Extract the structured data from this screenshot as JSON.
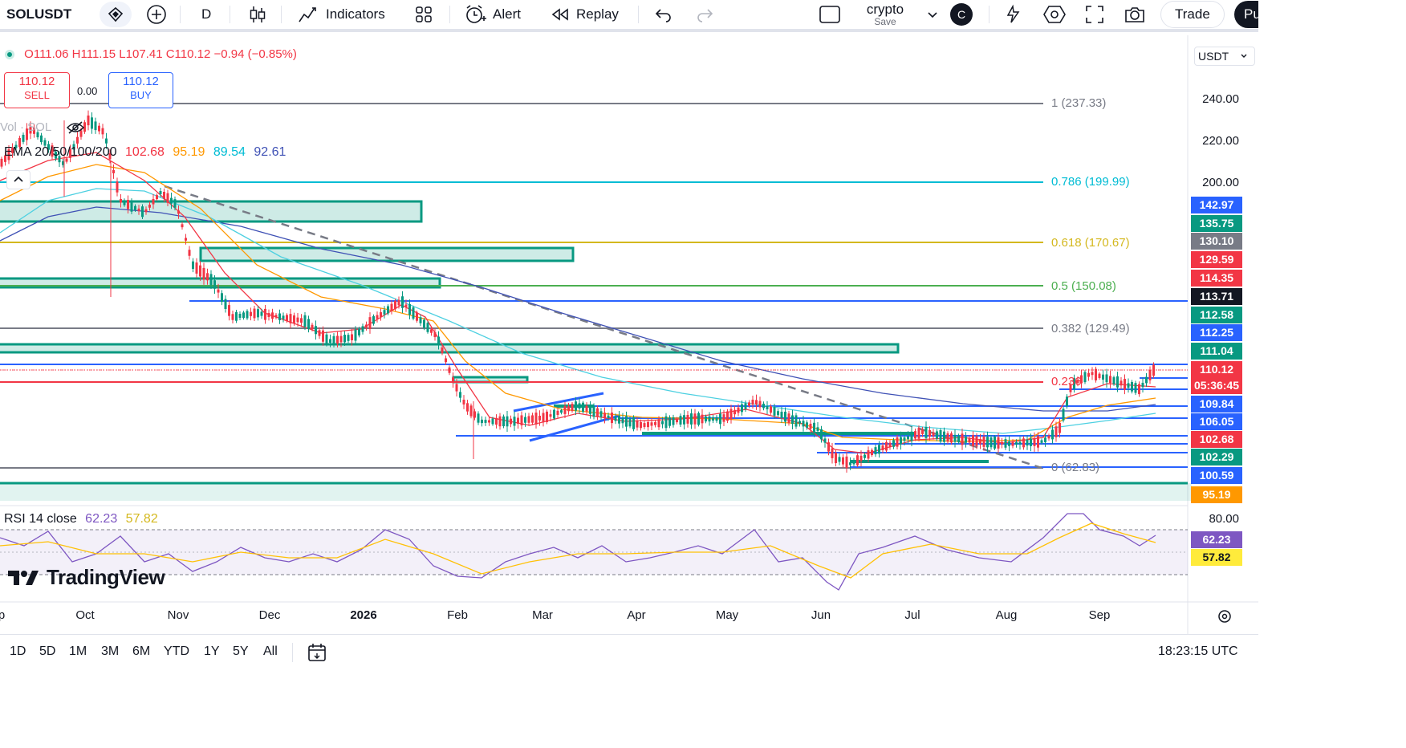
{
  "toolbar": {
    "symbol": "SOLUSDT",
    "interval": "D",
    "indicators": "Indicators",
    "alert": "Alert",
    "replay": "Replay",
    "layout_name": "crypto",
    "layout_save": "Save",
    "avatar_initial": "C",
    "trade": "Trade",
    "publish_partial": "Pu"
  },
  "legend": {
    "ohlc_line": "O111.06 H111.15 L107.41 C110.12 −0.94 (−0.85%)",
    "sell_price": "110.12",
    "sell_label": "SELL",
    "spread": "0.00",
    "buy_price": "110.12",
    "buy_label": "BUY",
    "vol_label": "Vol · SOL",
    "ema_label": "EMA 20/50/100/200",
    "ema20": "102.68",
    "ema50": "95.19",
    "ema100": "89.54",
    "ema200": "92.61",
    "rsi_label": "RSI 14 close",
    "rsi_value": "62.23",
    "rsi_ma": "57.82"
  },
  "currency": "USDT",
  "price_axis": [
    {
      "label": "240.00",
      "v": 240
    },
    {
      "label": "220.00",
      "v": 220
    },
    {
      "label": "200.00",
      "v": 200
    }
  ],
  "price_badges": [
    {
      "label": "142.97",
      "color": "#2962ff"
    },
    {
      "label": "135.75",
      "color": "#089981"
    },
    {
      "label": "130.10",
      "color": "#787b86"
    },
    {
      "label": "129.59",
      "color": "#f23645"
    },
    {
      "label": "114.35",
      "color": "#f23645"
    },
    {
      "label": "113.71",
      "color": "#131722"
    },
    {
      "label": "112.58",
      "color": "#089981"
    },
    {
      "label": "112.25",
      "color": "#2962ff"
    },
    {
      "label": "111.04",
      "color": "#089981"
    },
    {
      "label": "110.12",
      "color": "#f23645"
    },
    {
      "label": "05:36:45",
      "color": "#f23645"
    },
    {
      "label": "109.84",
      "color": "#2962ff"
    },
    {
      "label": "106.05",
      "color": "#2962ff"
    },
    {
      "label": "102.68",
      "color": "#f23645"
    },
    {
      "label": "102.29",
      "color": "#089981"
    },
    {
      "label": "100.59",
      "color": "#2962ff"
    },
    {
      "label": "95.19",
      "color": "#ff9800"
    }
  ],
  "fib_levels": [
    {
      "label": "1 (237.33)",
      "color": "#787b86"
    },
    {
      "label": "0.786 (199.99)",
      "color": "#00bcd4"
    },
    {
      "label": "0.618 (170.67)",
      "color": "#d4b81e"
    },
    {
      "label": "0.5 (150.08)",
      "color": "#4caf50"
    },
    {
      "label": "0.382 (129.49)",
      "color": "#787b86"
    },
    {
      "label": "0.236",
      "color": "#f23645"
    },
    {
      "label": "0 (62.83)",
      "color": "#787b86"
    }
  ],
  "rsi_axis": [
    {
      "label": "80.00",
      "v": 80
    }
  ],
  "rsi_badges": [
    {
      "label": "62.23",
      "color": "#7e57c2"
    },
    {
      "label": "57.82",
      "color": "#ffeb3b"
    }
  ],
  "time_axis": [
    "Oct",
    "Nov",
    "Dec",
    "2026",
    "Feb",
    "Mar",
    "Apr",
    "May",
    "Jun",
    "Jul",
    "Aug",
    "Sep"
  ],
  "time_axis_partial": "p",
  "watermark": "TradingView",
  "ranges": [
    "1D",
    "5D",
    "1M",
    "3M",
    "6M",
    "YTD",
    "1Y",
    "5Y",
    "All"
  ],
  "clock": "18:23:15 UTC"
}
